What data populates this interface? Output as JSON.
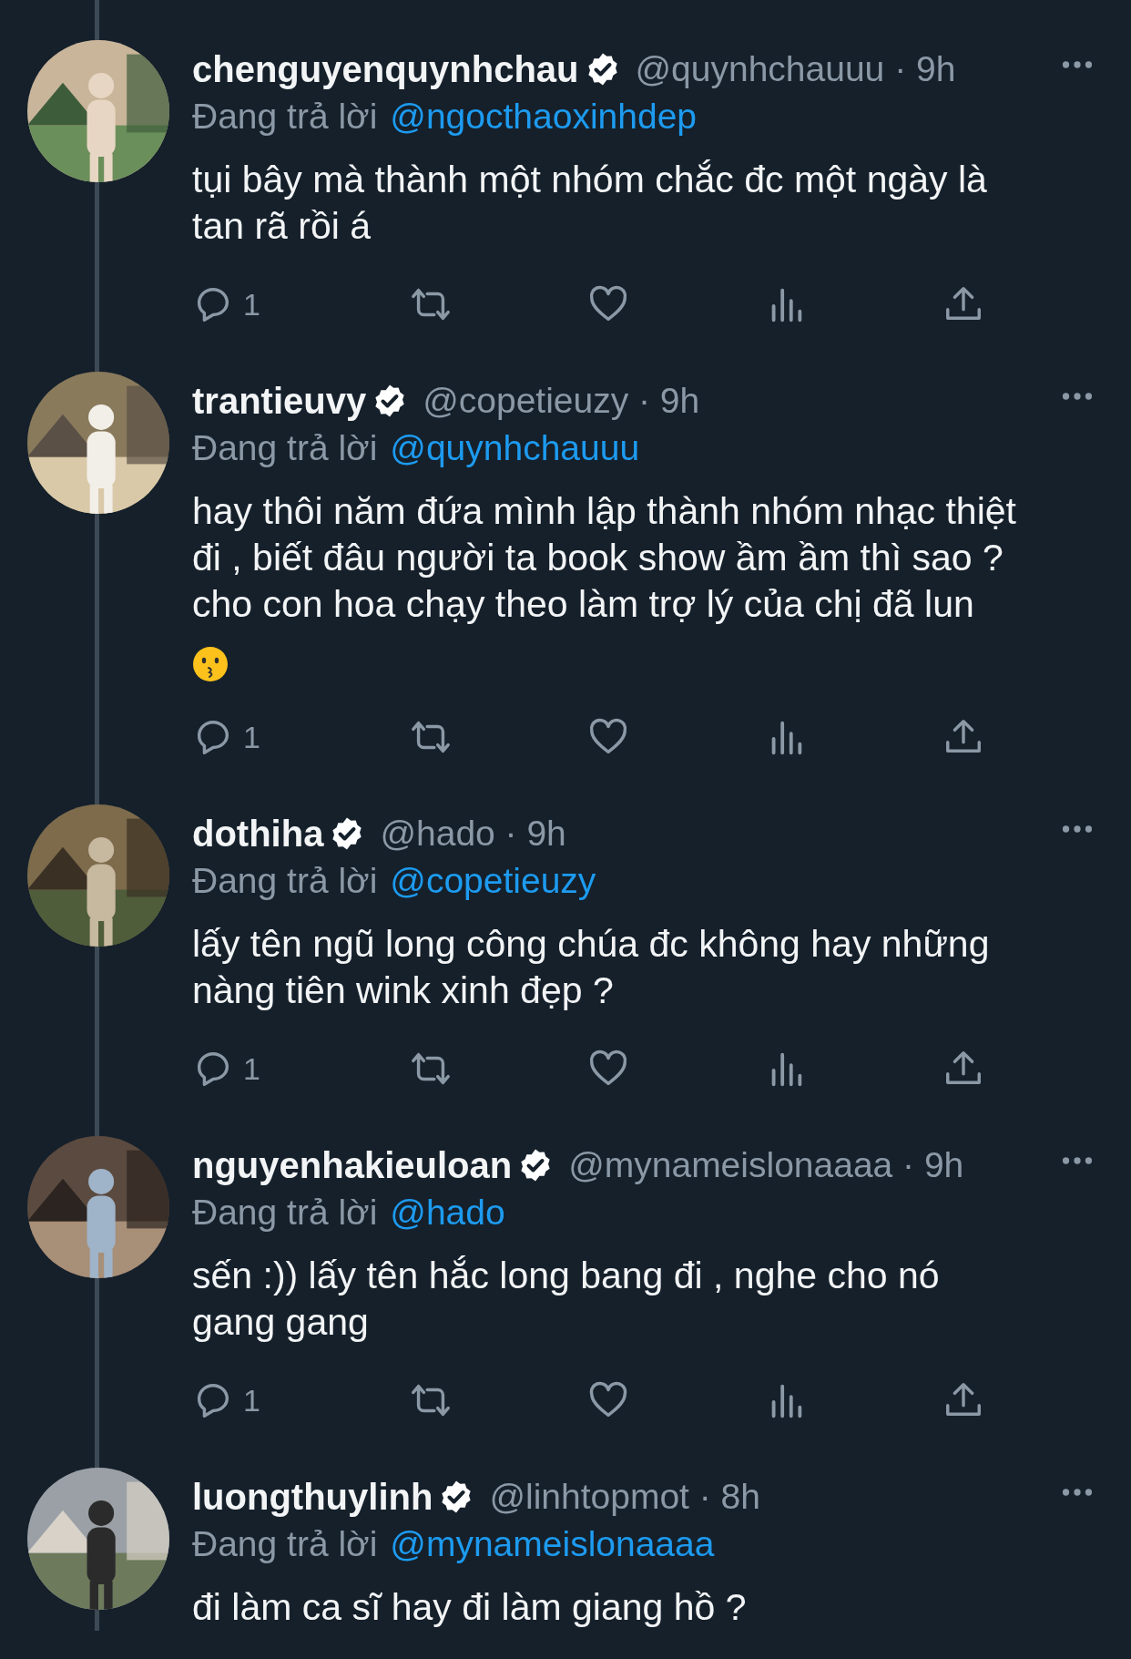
{
  "tweets": [
    {
      "name": "chenguyenquynhchau",
      "meta": "@quynhchauuu · 9h",
      "reply_prefix": "Đang trả lời",
      "reply_to": "@ngocthaoxinhdep",
      "lines": [
        "tụi bây mà thành một nhóm chắc đc một ngày là",
        "tan rã rồi á"
      ],
      "emoji": false,
      "reply_count": "1",
      "actions": true
    },
    {
      "name": "trantieuvy",
      "meta": "@copetieuzy · 9h",
      "reply_prefix": "Đang trả lời",
      "reply_to": "@quynhchauuu",
      "lines": [
        "hay thôi năm đứa mình lập thành nhóm nhạc thiệt",
        "đi , biết đâu người ta book show ầm ầm thì sao ?",
        "cho con hoa chạy theo làm trợ lý của chị đã lun"
      ],
      "emoji": true,
      "reply_count": "1",
      "actions": true
    },
    {
      "name": "dothiha",
      "meta": "@hado · 9h",
      "reply_prefix": "Đang trả lời",
      "reply_to": "@copetieuzy",
      "lines": [
        "lấy tên ngũ long công chúa đc không hay những",
        "nàng tiên wink xinh đẹp ?"
      ],
      "emoji": false,
      "reply_count": "1",
      "actions": true
    },
    {
      "name": "nguyenhakieuloan",
      "meta": "@mynameislonaaaa · 9h",
      "reply_prefix": "Đang trả lời",
      "reply_to": "@hado",
      "lines": [
        "sến :)) lấy tên hắc long bang đi , nghe cho nó",
        "gang gang"
      ],
      "emoji": false,
      "reply_count": "1",
      "actions": true
    },
    {
      "name": "luongthuylinh",
      "meta": "@linhtopmot · 8h",
      "reply_prefix": "Đang trả lời",
      "reply_to": "@mynameislonaaaa",
      "lines": [
        "đi làm ca sĩ hay đi làm giang hồ ?"
      ],
      "emoji": false,
      "actions": false
    }
  ]
}
